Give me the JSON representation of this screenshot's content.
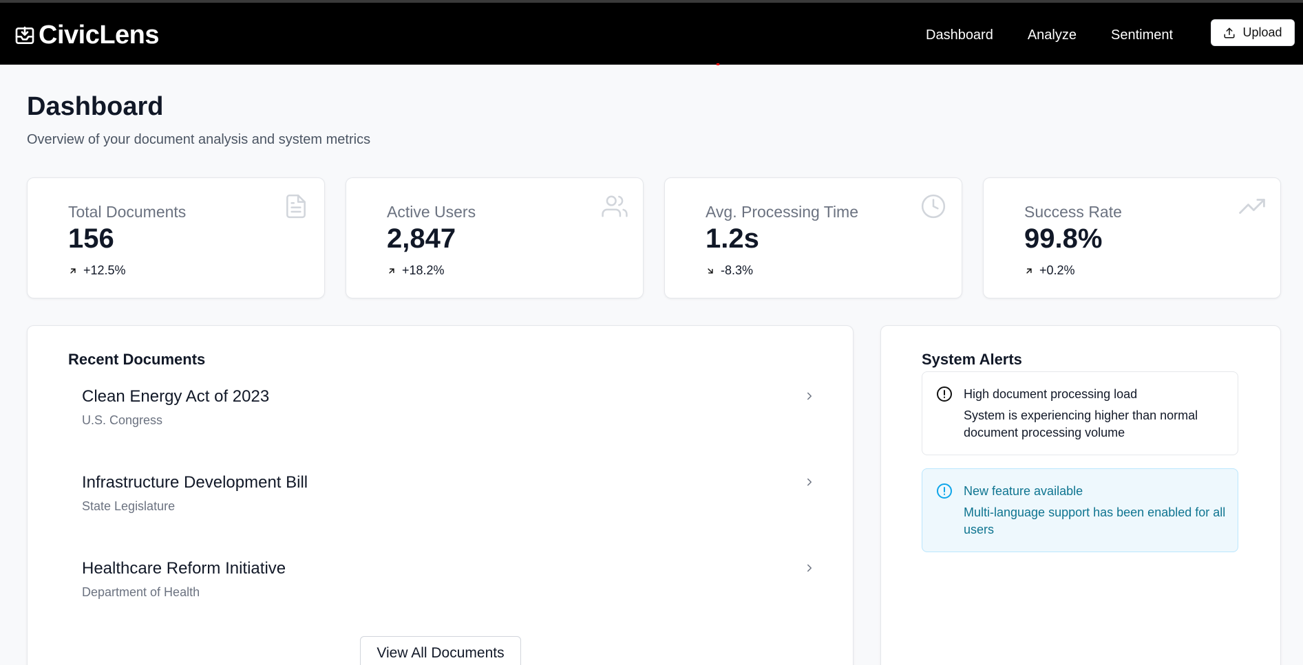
{
  "navbar": {
    "brand": "CivicLens",
    "links": [
      "Dashboard",
      "Analyze",
      "Sentiment"
    ],
    "upload_label": "Upload"
  },
  "header": {
    "title": "Dashboard",
    "subtitle": "Overview of your document analysis and system metrics"
  },
  "stats": [
    {
      "label": "Total Documents",
      "value": "156",
      "trend": "+12.5%",
      "direction": "up",
      "icon": "document-icon"
    },
    {
      "label": "Active Users",
      "value": "2,847",
      "trend": "+18.2%",
      "direction": "up",
      "icon": "users-icon"
    },
    {
      "label": "Avg. Processing Time",
      "value": "1.2s",
      "trend": "-8.3%",
      "direction": "down",
      "icon": "clock-icon"
    },
    {
      "label": "Success Rate",
      "value": "99.8%",
      "trend": "+0.2%",
      "direction": "up",
      "icon": "trending-up-icon"
    }
  ],
  "recent_documents": {
    "title": "Recent Documents",
    "items": [
      {
        "title": "Clean Energy Act of 2023",
        "source": "U.S. Congress"
      },
      {
        "title": "Infrastructure Development Bill",
        "source": "State Legislature"
      },
      {
        "title": "Healthcare Reform Initiative",
        "source": "Department of Health"
      }
    ],
    "view_all_label": "View All Documents"
  },
  "system_alerts": {
    "title": "System Alerts",
    "alerts": [
      {
        "type": "warning",
        "title": "High document processing load",
        "body": "System is experiencing higher than normal document processing volume"
      },
      {
        "type": "info",
        "title": "New feature available",
        "body": "Multi-language support has been enabled for all users"
      }
    ]
  },
  "colors": {
    "navbar_bg": "#000000",
    "page_bg": "#f8f9fb",
    "info_text": "#0e7490",
    "info_bg": "#eef8fd"
  }
}
